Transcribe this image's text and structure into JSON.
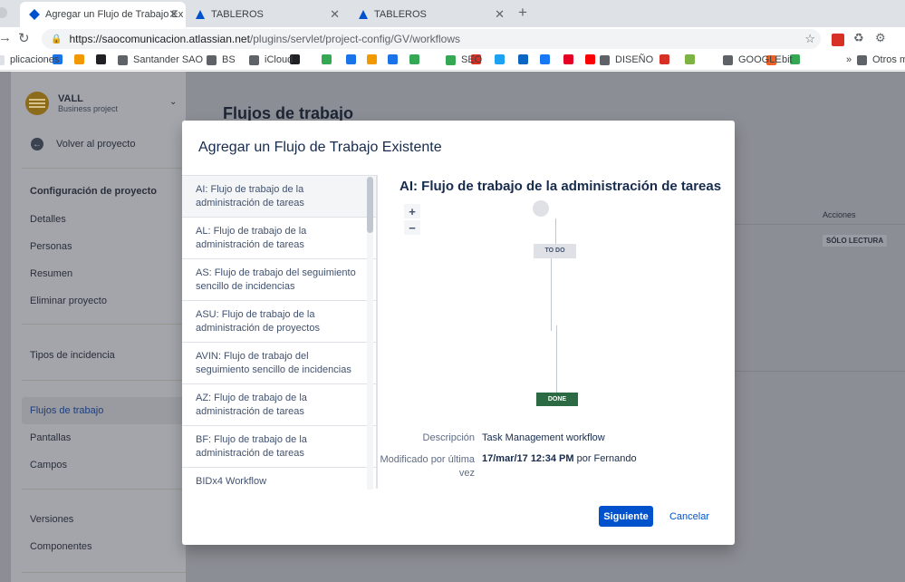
{
  "browser": {
    "tabs": [
      {
        "title": "Agregar un Flujo de Trabajo Ex",
        "active": true
      },
      {
        "title": "TABLEROS",
        "active": false
      },
      {
        "title": "TABLEROS",
        "active": false
      }
    ],
    "url_host": "https://saocomunicacion.atlassian.net",
    "url_path": "/plugins/servlet/project-config/GV/workflows",
    "bookmarks": [
      {
        "label": "plicaciones",
        "color": "#dee1e6"
      },
      {
        "label": "",
        "color": "#1a73e8"
      },
      {
        "label": "",
        "color": "#f29900"
      },
      {
        "label": "",
        "color": "#202124"
      },
      {
        "label": "Santander SAO",
        "color": "#5f6368"
      },
      {
        "label": "BS",
        "color": "#5f6368"
      },
      {
        "label": "iCloud",
        "color": "#5f6368"
      },
      {
        "label": "",
        "color": "#202124"
      },
      {
        "label": "",
        "color": "#34a853"
      },
      {
        "label": "",
        "color": "#1a73e8"
      },
      {
        "label": "",
        "color": "#f29900"
      },
      {
        "label": "",
        "color": "#1a73e8"
      },
      {
        "label": "",
        "color": "#34a853"
      },
      {
        "label": "SEO",
        "color": "#34a853"
      },
      {
        "label": "",
        "color": "#d93025"
      },
      {
        "label": "",
        "color": "#1da1f2"
      },
      {
        "label": "",
        "color": "#0a66c2"
      },
      {
        "label": "",
        "color": "#1877f2"
      },
      {
        "label": "",
        "color": "#e60023"
      },
      {
        "label": "",
        "color": "#ff0000"
      },
      {
        "label": "DISEÑO",
        "color": "#5f6368"
      },
      {
        "label": "",
        "color": "#d93025"
      },
      {
        "label": "",
        "color": "#7cb342"
      },
      {
        "label": "GOOGLE",
        "color": "#5f6368"
      },
      {
        "label": "bit",
        "color": "#ee6123"
      },
      {
        "label": "",
        "color": "#34a853"
      }
    ],
    "bookmarks_more": "»",
    "other_bookmarks": "Otros ma"
  },
  "sidebar": {
    "project_name": "VALL",
    "project_type": "Business project",
    "back_label": "Volver al proyecto",
    "section_title": "Configuración de proyecto",
    "items": [
      {
        "label": "Detalles"
      },
      {
        "label": "Personas"
      },
      {
        "label": "Resumen"
      },
      {
        "label": "Eliminar proyecto"
      },
      {
        "label": "Tipos de incidencia"
      },
      {
        "label": "Flujos de trabajo",
        "active": true
      },
      {
        "label": "Pantallas"
      },
      {
        "label": "Campos"
      },
      {
        "label": "Versiones"
      },
      {
        "label": "Componentes"
      }
    ]
  },
  "main": {
    "title": "Flujos de trabajo",
    "actions_header": "Acciones",
    "readonly_badge": "SÓLO LECTURA"
  },
  "modal": {
    "title": "Agregar un Flujo de Trabajo Existente",
    "workflows": [
      {
        "name": "AI: Flujo de trabajo de la administración de tareas",
        "selected": true
      },
      {
        "name": "AL: Flujo de trabajo de la administración de tareas"
      },
      {
        "name": "AS: Flujo de trabajo del seguimiento sencillo de incidencias"
      },
      {
        "name": "ASU: Flujo de trabajo de la administración de proyectos"
      },
      {
        "name": "AVIN: Flujo de trabajo del seguimiento sencillo de incidencias"
      },
      {
        "name": "AZ: Flujo de trabajo de la administración de tareas"
      },
      {
        "name": "BF: Flujo de trabajo de la administración de tareas"
      },
      {
        "name": "BIDx4 Workflow"
      }
    ],
    "detail": {
      "title": "AI: Flujo de trabajo de la administración de tareas",
      "zoom_in": "+",
      "zoom_out": "−",
      "status_todo": "TO DO",
      "status_done": "DONE",
      "description_label": "Descripción",
      "description_value": "Task Management workflow",
      "modified_label": "Modificado por última vez",
      "modified_date": "17/mar/17 12:34 PM",
      "modified_by": "por Fernando"
    },
    "next_button": "Siguiente",
    "cancel_button": "Cancelar"
  }
}
